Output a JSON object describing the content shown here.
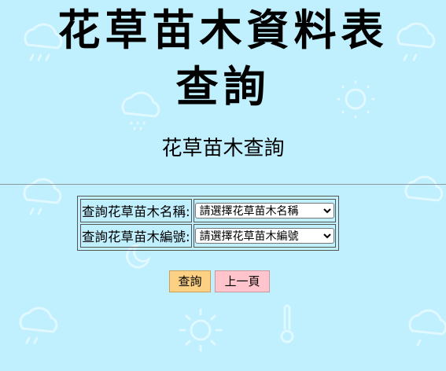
{
  "page": {
    "title_line1": "花草苗木資料表",
    "title_line2": "查詢",
    "subtitle": "花草苗木查詢"
  },
  "form": {
    "name_label": "查詢花草苗木名稱:",
    "name_select_value": "請選擇花草苗木名稱",
    "id_label": "查詢花草苗木編號:",
    "id_select_value": "請選擇花草苗木編號"
  },
  "buttons": {
    "query_label": "查詢",
    "back_label": "上一頁"
  },
  "colors": {
    "background": "#c0effd",
    "query_button": "#fdd184",
    "back_button": "#ffc4cc"
  },
  "icons": {
    "background_pattern": "weather-icons-pattern",
    "select_arrow": "chevron-down-icon"
  }
}
